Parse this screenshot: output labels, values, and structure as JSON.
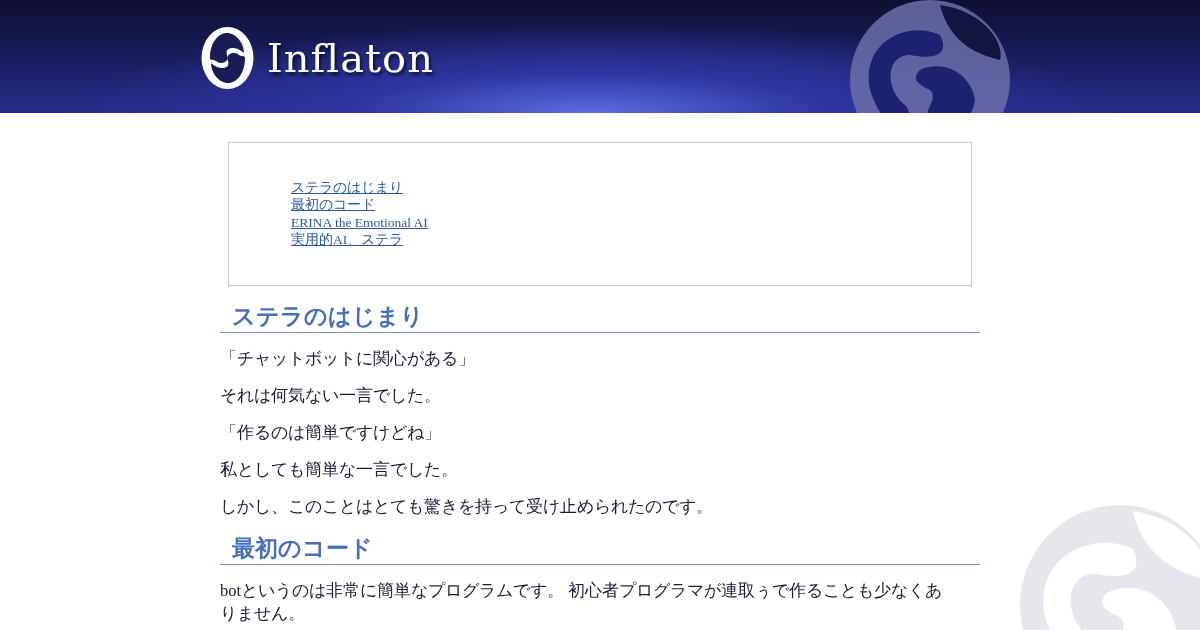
{
  "header": {
    "site_name": "Inflaton"
  },
  "toc": {
    "items": [
      {
        "label": "ステラのはじまり"
      },
      {
        "label": "最初のコード"
      },
      {
        "label": "ERINA the Emotional AI"
      },
      {
        "label": "実用的AI、ステラ"
      }
    ]
  },
  "sections": [
    {
      "heading": "ステラのはじまり",
      "paragraphs": [
        "「チャットボットに関心がある」",
        "それは何気ない一言でした。",
        "「作るのは簡単ですけどね」",
        "私としても簡単な一言でした。",
        "しかし、このことはとても驚きを持って受け止められたのです。"
      ]
    },
    {
      "heading": "最初のコード",
      "paragraphs": [
        "botというのは非常に簡単なプログラムです。 初心者プログラマが連取ぅで作ることも少なくありません。"
      ]
    }
  ]
}
